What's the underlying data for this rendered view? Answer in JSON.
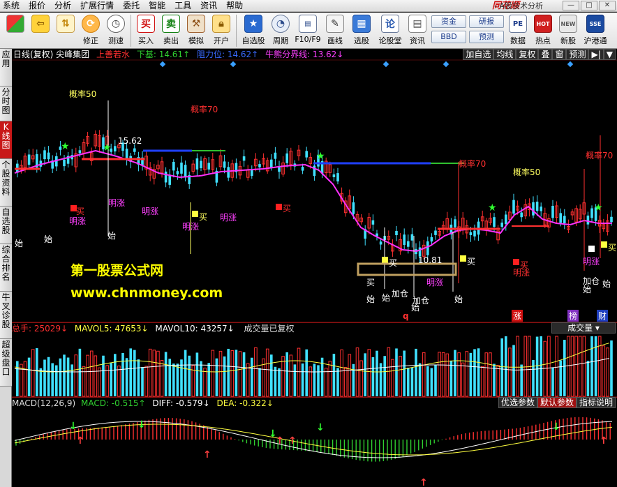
{
  "menu": [
    "系统",
    "报价",
    "分析",
    "扩展行情",
    "委托",
    "智能",
    "工具",
    "资讯",
    "帮助"
  ],
  "brand": "同花顺",
  "brand_sub": "- A股技术分析",
  "window_controls": [
    "—",
    "□",
    "✕"
  ],
  "toolbar": {
    "buttons": [
      {
        "label": "",
        "icon": "layout-grid-icon"
      },
      {
        "label": "",
        "icon": "back-arrow-icon"
      },
      {
        "label": "",
        "icon": "up-down-arrows-icon"
      },
      {
        "label": "修正",
        "icon": "refresh-icon"
      },
      {
        "label": "测速",
        "icon": "clock-icon"
      },
      {
        "label": "买入",
        "icon": "buy-icon"
      },
      {
        "label": "卖出",
        "icon": "sell-icon"
      },
      {
        "label": "模拟",
        "icon": "hammer-icon"
      },
      {
        "label": "开户",
        "icon": "lock-icon"
      },
      {
        "label": "自选股",
        "icon": "star-icon"
      },
      {
        "label": "周期",
        "icon": "cycle-icon"
      },
      {
        "label": "F10/F9",
        "icon": "f10-icon"
      },
      {
        "label": "画线",
        "icon": "pen-icon"
      },
      {
        "label": "选股",
        "icon": "select-stock-icon"
      },
      {
        "label": "论股堂",
        "icon": "forum-icon"
      },
      {
        "label": "资讯",
        "icon": "news-icon"
      },
      {
        "label": "数据",
        "icon": "pe-icon"
      },
      {
        "label": "热点",
        "icon": "hot-icon"
      },
      {
        "label": "新股",
        "icon": "new-stock-icon"
      },
      {
        "label": "沪港通",
        "icon": "hk-connect-icon"
      }
    ],
    "icon_glyphs": {
      "buy": "买",
      "sell": "卖",
      "pe": "PE",
      "hot": "HOT",
      "new": "NEW",
      "sse": "SSE"
    },
    "pills": [
      "资金",
      "研报",
      "BBD",
      "预测"
    ]
  },
  "left_tabs": [
    "应用",
    "分时图",
    "K线图",
    "个股资料",
    "自选股",
    "综合排名",
    "牛叉诊股",
    "超级盘口"
  ],
  "kline": {
    "title": "日线(复权) 尖峰集团",
    "items": [
      {
        "text": "上善若水",
        "color": "#ff3030"
      },
      {
        "text": "下基: 14.61↑",
        "color": "#30d030"
      },
      {
        "text": "阻力位: 14.62↑",
        "color": "#3060ff"
      },
      {
        "text": "牛熊分界线: 13.62↓",
        "color": "#ff40ff"
      }
    ],
    "buttons": [
      "加自选",
      "均线",
      "复权",
      "叠",
      "窗",
      "预测",
      "▶|",
      "▼"
    ],
    "price_high": "15.62",
    "price_low": "10.81",
    "labels": {
      "prob50_a": "概率50",
      "prob70_a": "概率70",
      "prob70_b": "概率70",
      "prob50_b": "概率50",
      "prob70_c": "概率70",
      "mingzhang": "明涨",
      "mai": "买",
      "shi": "始",
      "jiacang": "加仓",
      "zhang": "涨",
      "bang": "榜",
      "cai": "财",
      "q": "q"
    },
    "watermark1": "第一股票公式网",
    "watermark2": "www.chnmoney.com"
  },
  "volume": {
    "items": [
      {
        "text": "总手: 25029↓",
        "color": "#ff3030"
      },
      {
        "text": "MAVOL5: 47653↓",
        "color": "#ffff40"
      },
      {
        "text": "MAVOL10: 43257↓",
        "color": "#ffffff"
      },
      {
        "text": "成交量已复权",
        "color": "#dddddd"
      }
    ],
    "dropdown": "成交量"
  },
  "macd": {
    "items": [
      {
        "text": "MACD(12,26,9)",
        "color": "#dddddd"
      },
      {
        "text": "MACD: -0.515↑",
        "color": "#30d030"
      },
      {
        "text": "DIFF: -0.579↓",
        "color": "#ffffff"
      },
      {
        "text": "DEA: -0.322↓",
        "color": "#ffff40"
      }
    ],
    "buttons": [
      "优选参数",
      "默认参数",
      "指标说明"
    ]
  }
}
